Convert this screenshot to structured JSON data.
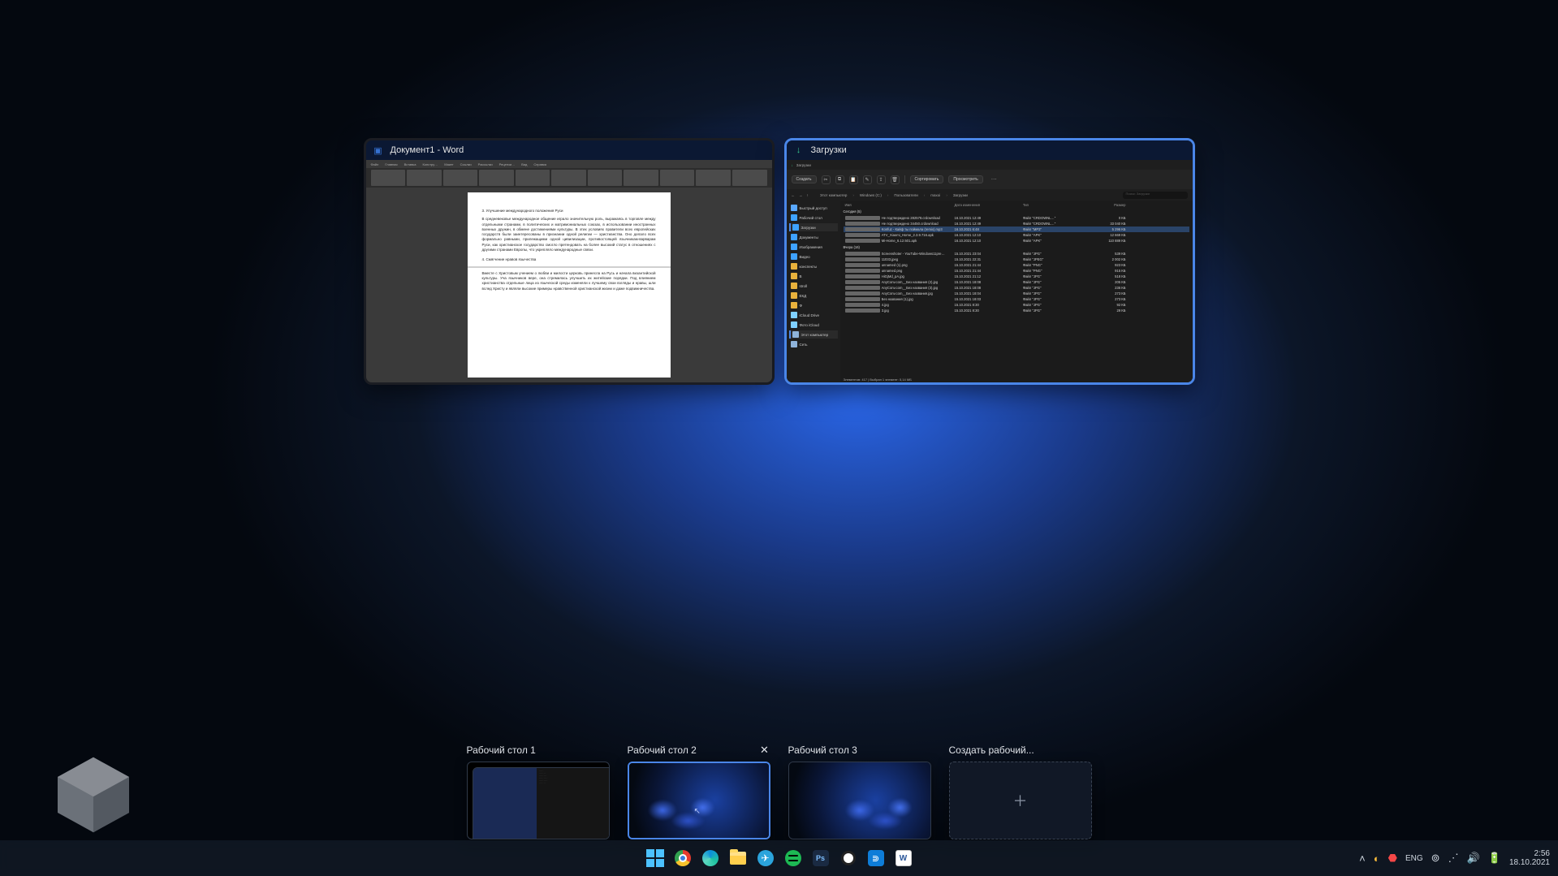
{
  "windows": {
    "word": {
      "title": "Документ1 - Word",
      "tabs": [
        "Файл",
        "Главная",
        "Вставка",
        "Констру…",
        "Макет",
        "Ссылки",
        "Рассылки",
        "Рецензи…",
        "Вид",
        "Справка"
      ],
      "heading1": "3. Улучшение международного положения Руси",
      "para1": "В средневековье международное общение играло значительную роль, выражаясь в торговле между отдельными странами, в политических и матримониальных союзах, в использовании иностранных военных дружин, в обмене достижениями культуры. В этих условиях правители всех европейских государств были заинтересованы в признании одной религии — христианства. Оно делало всех формально равными, прилежащими одной цивилизации, противостоящей язычникам-варварам Руси, как христианское государство смогло претендовать на более высокий статус в отношениях с другими странами Европы, что укрепляло международные связи.",
      "heading2": "4. Смягчение нравов язычества",
      "para2": "Вместе с Христовым учением о любви и милости церковь принесла на Русь и начала византийской культуры. Уча язычников вере, она стремилась улучшить их житейские порядки. Под влиянием христианства отдельные лица из языческой среды изменяли к лучшему свои взгляды и нравы, шли вслед Христу и являли высокие примеры нравственной христианской жизни и даже подвижничества."
    },
    "explorer": {
      "title": "Загрузки",
      "tab": "Загрузки",
      "createBtn": "Создать",
      "sortBtn": "Сортировать",
      "viewBtn": "Просмотреть",
      "crumbs": [
        "Этот компьютер",
        "Windows (C:)",
        "Пользователи",
        "maxoi",
        "Загрузки"
      ],
      "searchPlaceholder": "Поиск: Загрузки",
      "columns": [
        "Имя",
        "Дата изменения",
        "Тип",
        "Размер"
      ],
      "side": [
        {
          "label": "Быстрый доступ",
          "icon": "#59a8ff"
        },
        {
          "label": "Рабочий стол",
          "icon": "#3ea2ff"
        },
        {
          "label": "Загрузки",
          "icon": "#3ea2ff",
          "sel": true
        },
        {
          "label": "Документы",
          "icon": "#3ea2ff"
        },
        {
          "label": "Изображения",
          "icon": "#3ea2ff"
        },
        {
          "label": "Видео",
          "icon": "#3ea2ff"
        },
        {
          "label": "конспекты",
          "icon": "#e8b13c"
        },
        {
          "label": "B",
          "icon": "#e8b13c"
        },
        {
          "label": "stroll",
          "icon": "#e8b13c"
        },
        {
          "label": "ЕКД",
          "icon": "#e8b13c"
        },
        {
          "label": "Ф",
          "icon": "#e8b13c"
        },
        {
          "label": "iCloud Drive",
          "icon": "#7fd0ff"
        },
        {
          "label": "Фото iCloud",
          "icon": "#7fd0ff"
        },
        {
          "label": "Этот компьютер",
          "icon": "#8fb3d9",
          "hl": true
        },
        {
          "label": "Сеть",
          "icon": "#8fb3d9"
        }
      ],
      "groupToday": "Сегодня (5)",
      "groupYest": "Вчера (16)",
      "rowsToday": [
        {
          "name": "Не подтверждено 282578.crdownload",
          "date": "16.10.2021 12:49",
          "type": "Файл \"CRDOWNL…\"",
          "size": "0 КБ"
        },
        {
          "name": "Не подтверждено 34450.crdownload",
          "date": "16.10.2021 12:49",
          "type": "Файл \"CRDOWNL…\"",
          "size": "33 040 КБ"
        },
        {
          "name": "Konfuz - Кайф ты поймала (remix).mp3",
          "date": "16.10.2021 6:48",
          "type": "Файл \"MP3\"",
          "size": "5 296 КБ",
          "sel": true
        },
        {
          "name": "ATV_Xiaomi_Home_2.3.9.716.apk",
          "date": "16.10.2021 12:10",
          "type": "Файл \"APK\"",
          "size": "12 669 КБ"
        },
        {
          "name": "Mi-Home_6.12.501.apk",
          "date": "16.10.2021 12:10",
          "type": "Файл \"APK\"",
          "size": "110 889 КБ"
        }
      ],
      "rowsYest": [
        {
          "name": "Screenshoter - YouTube-Windows11pre…",
          "date": "15.10.2021 23:04",
          "type": "Файл \"JPG\"",
          "size": "539 КБ"
        },
        {
          "name": "11033.jpeg",
          "date": "15.10.2021 22:31",
          "type": "Файл \"JPEG\"",
          "size": "2 002 КБ"
        },
        {
          "name": "unnamed (1).png",
          "date": "15.10.2021 21:44",
          "type": "Файл \"PNG\"",
          "size": "923 КБ"
        },
        {
          "name": "unnamed.png",
          "date": "15.10.2021 21:44",
          "type": "Файл \"PNG\"",
          "size": "915 КБ"
        },
        {
          "name": "HiGjMd_pA.jpg",
          "date": "15.10.2021 21:12",
          "type": "Файл \"JPG\"",
          "size": "518 КБ"
        },
        {
          "name": "AnyConv.com__Без названия (2).jpg",
          "date": "15.10.2021 18:08",
          "type": "Файл \"JPG\"",
          "size": "205 КБ"
        },
        {
          "name": "AnyConv.com__Без названия (3).jpg",
          "date": "15.10.2021 18:08",
          "type": "Файл \"JPG\"",
          "size": "236 КБ"
        },
        {
          "name": "AnyConv.com__Без названия.jpg",
          "date": "15.10.2021 18:04",
          "type": "Файл \"JPG\"",
          "size": "273 КБ"
        },
        {
          "name": "Без названия (1).jpg",
          "date": "15.10.2021 18:03",
          "type": "Файл \"JPG\"",
          "size": "273 КБ"
        },
        {
          "name": "4.jpg",
          "date": "15.10.2021 8:30",
          "type": "Файл \"JPG\"",
          "size": "92 КБ"
        },
        {
          "name": "3.jpg",
          "date": "15.10.2021 8:30",
          "type": "Файл \"JPG\"",
          "size": "29 КБ"
        }
      ],
      "status": "Элементов: 417   |   Выбран 1 элемент: 5,14 МБ"
    }
  },
  "desktops": {
    "d1": "Рабочий стол 1",
    "d2": "Рабочий стол 2",
    "d3": "Рабочий стол 3",
    "add": "Создать рабочий..."
  },
  "taskbar": {
    "lang": "ENG",
    "time": "2:56",
    "date": "18.10.2021"
  }
}
